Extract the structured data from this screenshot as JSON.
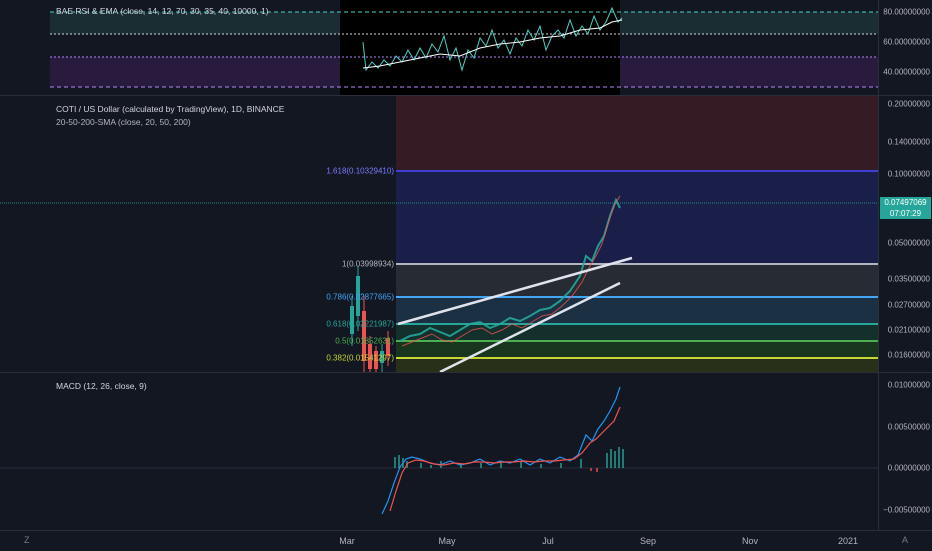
{
  "rsi_pane": {
    "legend": "BAE RSI & EMA (close, 14, 12, 70, 30, 35, 40, 10000, 1)",
    "axis_labels": [
      "80.00000000",
      "60.00000000",
      "40.00000000"
    ]
  },
  "main_pane": {
    "title": "COTI / US Dollar (calculated by TradingView), 1D, BINANCE",
    "indicator": "20-50-200-SMA (close, 20, 50, 200)",
    "axis_labels": [
      "0.20000000",
      "0.14000000",
      "0.10000000",
      "0.05000000",
      "0.03500000",
      "0.02700000",
      "0.02100000",
      "0.01600000"
    ],
    "current_price": "0.07497069",
    "countdown": "07:07:29",
    "fib_levels": [
      {
        "label": "1.618(0.10329410)",
        "color": "#3f3fd6"
      },
      {
        "label": "1(0.03998934)",
        "color": "#b2b5be"
      },
      {
        "label": "0.786(0.02877665)",
        "color": "#42a5f5"
      },
      {
        "label": "0.618(0.02221987)",
        "color": "#26a69a"
      },
      {
        "label": "0.5(0.01852631)",
        "color": "#4caf50"
      },
      {
        "label": "0.382(0.01541297)",
        "color": "#c6d635"
      }
    ]
  },
  "macd_pane": {
    "legend": "MACD (12, 26, close, 9)",
    "axis_labels": [
      "0.01000000",
      "0.00500000",
      "0.00000000",
      "−0.00500000"
    ]
  },
  "time_axis": {
    "labels": [
      "Mar",
      "May",
      "Jul",
      "Sep",
      "Nov",
      "2021"
    ]
  },
  "corner": {
    "left": "Z",
    "right": "A"
  },
  "colors": {
    "background": "#131722",
    "up": "#26a69a",
    "down": "#ef5350",
    "rsi_line": "#4dd0c4"
  }
}
